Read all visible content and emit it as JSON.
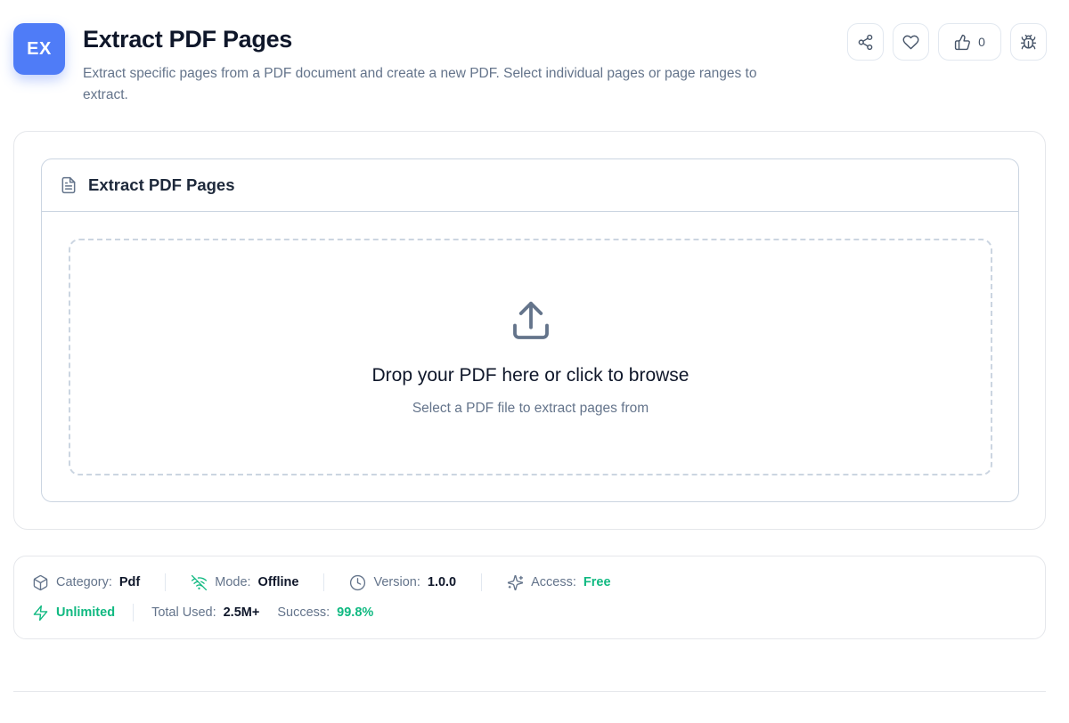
{
  "header": {
    "badge": "EX",
    "title": "Extract PDF Pages",
    "subtitle": "Extract specific pages from a PDF document and create a new PDF. Select individual pages or page ranges to extract.",
    "like_count": "0"
  },
  "card": {
    "title": "Extract PDF Pages",
    "drop_title": "Drop your PDF here or click to browse",
    "drop_subtitle": "Select a PDF file to extract pages from"
  },
  "meta": {
    "category_label": "Category:",
    "category_value": "Pdf",
    "mode_label": "Mode:",
    "mode_value": "Offline",
    "version_label": "Version:",
    "version_value": "1.0.0",
    "access_label": "Access:",
    "access_value": "Free",
    "unlimited": "Unlimited",
    "total_used_label": "Total Used:",
    "total_used_value": "2.5M+",
    "success_label": "Success:",
    "success_value": "99.8%"
  },
  "colors": {
    "accent": "#4f7cf7",
    "success": "#10b981",
    "muted": "#64748b"
  }
}
